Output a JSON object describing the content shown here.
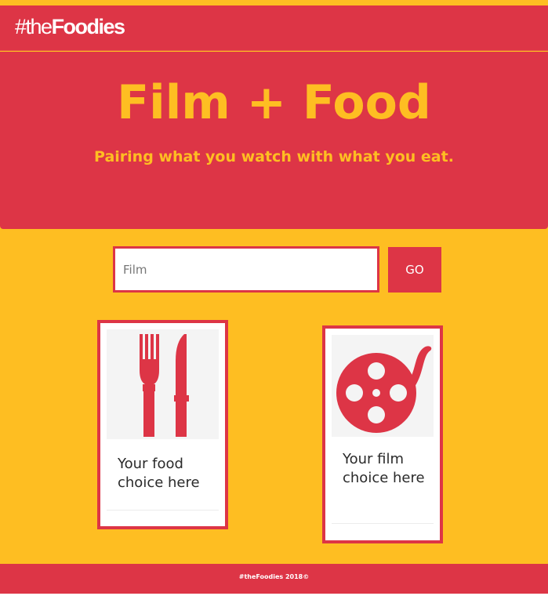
{
  "navbar": {
    "brand_prefix": "#the",
    "brand_bold": "Foodies"
  },
  "hero": {
    "title": "Film + Food",
    "subtitle": "Pairing what you watch with what you eat."
  },
  "search": {
    "placeholder": "Film",
    "value": "",
    "go_label": "GO"
  },
  "cards": {
    "food": {
      "text": "Your food choice here",
      "icon": "fork-knife-icon"
    },
    "film": {
      "text": "Your film choice here",
      "icon": "film-reel-icon"
    }
  },
  "footer": {
    "text": "#theFoodies 2018©"
  },
  "colors": {
    "primary_red": "#dd3546",
    "accent_yellow": "#febe22"
  }
}
